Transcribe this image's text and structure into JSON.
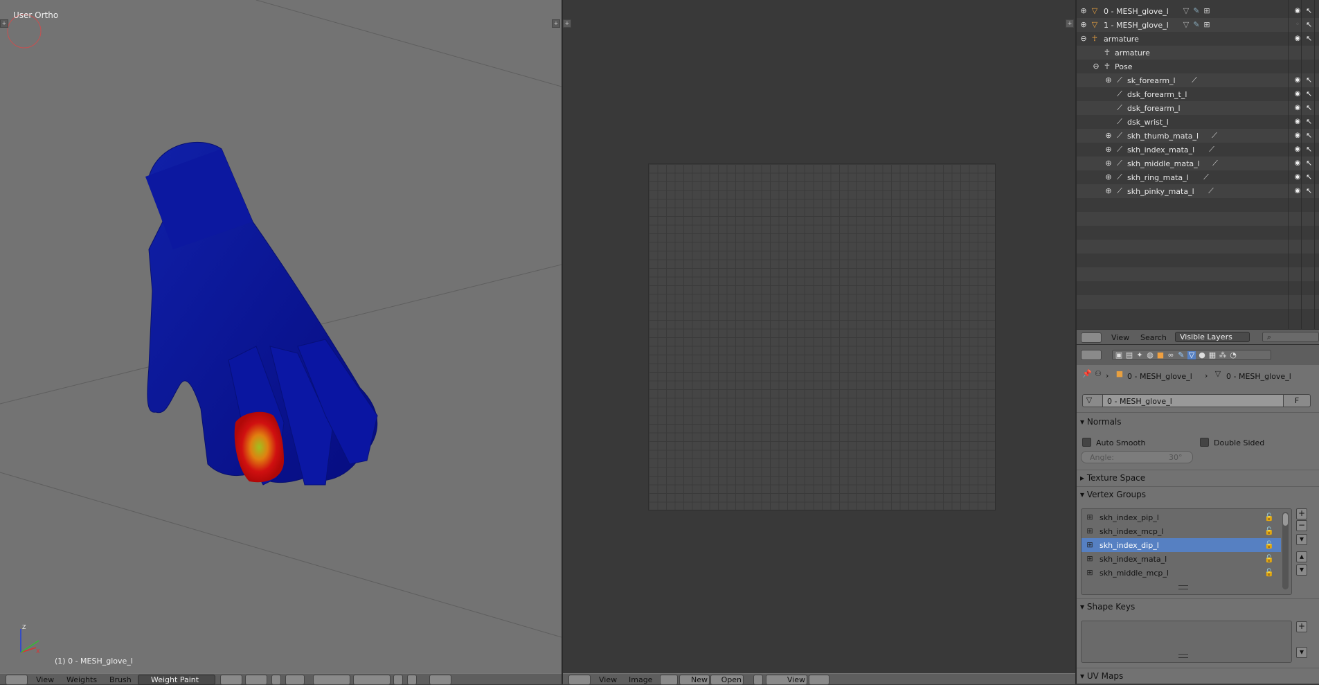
{
  "viewport": {
    "title": "User Ortho",
    "object_label": "(1) 0 - MESH_glove_l",
    "header": {
      "view": "View",
      "weights": "Weights",
      "brush": "Brush",
      "mode": "Weight Paint"
    }
  },
  "uv_editor": {
    "header": {
      "view": "View",
      "image": "Image",
      "new": "New",
      "open": "Open",
      "view2": "View"
    }
  },
  "outliner": {
    "rows": [
      {
        "label": "0 - MESH_glove_l",
        "type": "mesh"
      },
      {
        "label": "1 - MESH_glove_l",
        "type": "mesh"
      },
      {
        "label": "armature",
        "type": "armature-object"
      },
      {
        "label": "armature",
        "type": "armature-data"
      },
      {
        "label": "Pose",
        "type": "pose"
      },
      {
        "label": "sk_forearm_l",
        "type": "bone"
      },
      {
        "label": "dsk_forearm_t_l",
        "type": "bone"
      },
      {
        "label": "dsk_forearm_l",
        "type": "bone"
      },
      {
        "label": "dsk_wrist_l",
        "type": "bone"
      },
      {
        "label": "skh_thumb_mata_l",
        "type": "bone"
      },
      {
        "label": "skh_index_mata_l",
        "type": "bone"
      },
      {
        "label": "skh_middle_mata_l",
        "type": "bone"
      },
      {
        "label": "skh_ring_mata_l",
        "type": "bone"
      },
      {
        "label": "skh_pinky_mata_l",
        "type": "bone"
      }
    ],
    "header": {
      "view": "View",
      "search": "Search",
      "filter": "Visible Layers"
    }
  },
  "properties": {
    "breadcrumb_object": "0 - MESH_glove_l",
    "breadcrumb_mesh": "0 - MESH_glove_l",
    "mesh_name": "0 - MESH_glove_l",
    "fake_user": "F",
    "normals": {
      "title": "Normals",
      "auto_smooth": "Auto Smooth",
      "double_sided": "Double Sided",
      "angle_label": "Angle:",
      "angle_value": "30°"
    },
    "texture_space": "Texture Space",
    "vertex_groups": {
      "title": "Vertex Groups",
      "items": [
        "skh_index_pip_l",
        "skh_index_mcp_l",
        "skh_index_dip_l",
        "skh_index_mata_l",
        "skh_middle_mcp_l"
      ],
      "selected_index": 2
    },
    "shape_keys": "Shape Keys",
    "uv_maps": "UV Maps"
  },
  "colors": {
    "viewport_bg": "#737373",
    "editor_bg": "#393939",
    "selection": "#5680c2",
    "mesh_blue": "#0a14a0"
  }
}
